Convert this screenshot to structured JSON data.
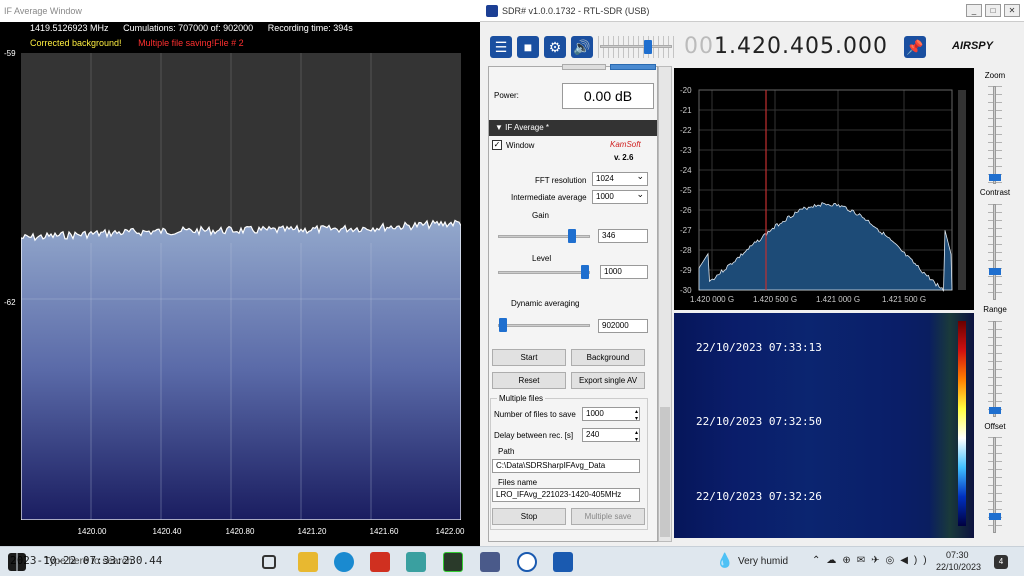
{
  "left_window": {
    "title": "IF Average Window",
    "frequency": "1419.5126923 MHz",
    "cumulations": "Cumulations: 707000 of: 902000",
    "recording_time": "Recording time: 394s",
    "status_corrected": "Corrected background!",
    "status_multiple": "Multiple file saving!File # 2",
    "y_ticks": [
      "-59",
      "-62"
    ],
    "x_ticks": [
      "1420.00",
      "1420.40",
      "1420.80",
      "1421.20",
      "1421.60",
      "1422.00"
    ]
  },
  "right_window": {
    "title": "SDR# v1.0.0.1732 - RTL-SDR (USB)",
    "window_buttons": [
      "_",
      "□",
      "✕"
    ],
    "frequency_dim": "00",
    "frequency_main": "1.420.405.000",
    "brand": "AIRSPY",
    "toolbar_icons": [
      "menu-icon",
      "stop-icon",
      "gear-icon",
      "speaker-icon",
      "pin-icon"
    ]
  },
  "panel": {
    "power_label": "Power:",
    "power_value": "0.00 dB",
    "section_title": "IF Average *",
    "window_label": "Window",
    "kamsoft": "KamSoft",
    "version": "v. 2.6",
    "fft_label": "FFT resolution",
    "fft_value": "1024",
    "intermediate_label": "Intermediate average",
    "intermediate_value": "1000",
    "gain_label": "Gain",
    "gain_value": "346",
    "level_label": "Level",
    "level_value": "1000",
    "dyn_label": "Dynamic averaging",
    "dyn_value": "902000",
    "btn_start": "Start",
    "btn_background": "Background",
    "btn_reset": "Reset",
    "btn_export": "Export single AV",
    "multiple_files": "Multiple files",
    "num_files_label": "Number of files to save",
    "num_files_value": "1000",
    "delay_label": "Delay between rec. [s]",
    "delay_value": "240",
    "path_label": "Path",
    "path_value": "C:\\Data\\SDRSharpIFAvg_Data",
    "files_name_label": "Files name",
    "files_name_value": "LRO_IFAvg_221023-1420-405MHz",
    "btn_stop": "Stop",
    "btn_multiple_save": "Multiple save"
  },
  "spectrum": {
    "y_ticks": [
      "-20",
      "-21",
      "-22",
      "-23",
      "-24",
      "-25",
      "-26",
      "-27",
      "-28",
      "-29",
      "-30"
    ],
    "x_ticks": [
      "1.420 000 G",
      "1.420 500 G",
      "1.421 000 G",
      "1.421 500 G"
    ]
  },
  "waterfall": {
    "timestamps": [
      "22/10/2023 07:33:13",
      "22/10/2023 07:32:50",
      "22/10/2023 07:32:26"
    ]
  },
  "side_controls": {
    "zoom": "Zoom",
    "contrast": "Contrast",
    "range": "Range",
    "offset": "Offset"
  },
  "taskbar": {
    "search_text": "Type here to search",
    "overlay_text": "2023-10-22 07:33:230.44",
    "weather": "Very humid",
    "time": "07:30",
    "date": "22/10/2023",
    "notifications": "4"
  },
  "colors": {
    "accent": "#1a4fa0",
    "spectrum_fill": "#1d4b77",
    "left_fill_top": "#8aa0c4",
    "left_fill_bottom": "#1a1f63"
  }
}
